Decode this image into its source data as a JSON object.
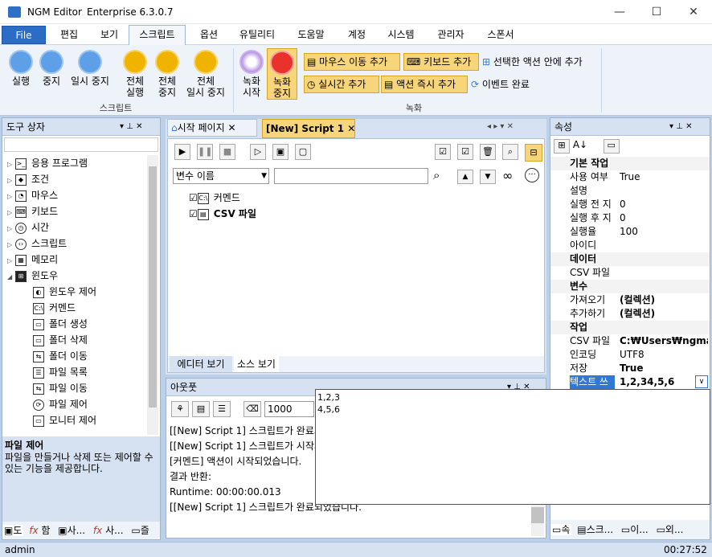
{
  "app": {
    "name": "NGM Editor",
    "edition": "Enterprise 6.3.0.7"
  },
  "window": {
    "minimize": "—",
    "maximize": "☐",
    "close": "✕"
  },
  "menu": {
    "file": "File",
    "items": [
      "편집",
      "보기",
      "스크립트",
      "옵션",
      "유틸리티",
      "도움말",
      "계정",
      "시스템",
      "관리자",
      "스폰서"
    ]
  },
  "ribbon": {
    "script_buttons": [
      "실행",
      "중지",
      "일시 중지"
    ],
    "batch_buttons": [
      [
        "전체",
        "실행"
      ],
      [
        "전체",
        "중지"
      ],
      [
        "전체",
        "일시 중지"
      ]
    ],
    "group_script": "스크립트",
    "record_buttons": [
      [
        "녹화",
        "시작"
      ],
      [
        "녹화",
        "중지"
      ]
    ],
    "small": [
      "마우스 이동 추가",
      "키보드 추가",
      "선택한 액션 안에 추가",
      "실시간 추가",
      "액션 즉시 추가",
      "이벤트 완료"
    ],
    "group_record": "녹화"
  },
  "toolbox": {
    "title": "도구 상자",
    "items": [
      "응용 프로그램",
      "조건",
      "마우스",
      "키보드",
      "시간",
      "스크립트",
      "메모리",
      "윈도우"
    ],
    "children": [
      "윈도우 제어",
      "커멘드",
      "폴더 생성",
      "폴더 삭제",
      "폴더 이동",
      "파일 목록",
      "파일 이동",
      "파일 제어",
      "모니터 제어"
    ],
    "desc_title": "파일 제어",
    "desc_text": "파일을 만들거나 삭제 또는 제어할 수 있는 기능을 제공합니다.",
    "bottom_tabs": [
      "도",
      "함",
      "사...",
      "사...",
      "즐"
    ]
  },
  "editor": {
    "tab_start": "시작 페이지",
    "tab_script": "[New] Script 1",
    "var_select": "변수 이름",
    "nodes": [
      "커멘드",
      "CSV 파일"
    ],
    "view_tabs": [
      "에디터 보기",
      "소스 보기"
    ]
  },
  "output": {
    "title": "아웃풋",
    "count": "1000",
    "lines": [
      "[[New] Script 1] 스크립트가 완료되었습니다.",
      "[[New] Script 1] 스크립트가 시작되었습니다.",
      "[커멘드] 액션이 시작되었습니다.",
      "결과 반환:",
      "Runtime: 00:00:00.013",
      "[[New] Script 1] 스크립트가 완료되었습니다."
    ]
  },
  "properties": {
    "title": "속성",
    "sections": {
      "basic": "기본 작업",
      "data": "데이터",
      "var": "변수",
      "work": "작업"
    },
    "basic": [
      [
        "사용 여부",
        "True"
      ],
      [
        "설명",
        ""
      ],
      [
        "실행 전 지",
        "0"
      ],
      [
        "실행 후 지",
        "0"
      ],
      [
        "실행율",
        "100"
      ],
      [
        "아이디",
        ""
      ]
    ],
    "data": [
      [
        "CSV 파일",
        ""
      ]
    ],
    "var": [
      [
        "가져오기",
        "(컬렉션)"
      ],
      [
        "추가하기",
        "(컬렉션)"
      ]
    ],
    "work": [
      [
        "CSV 파일",
        "C:₩Users₩ngma"
      ],
      [
        "인코딩",
        "UTF8"
      ],
      [
        "저장",
        "True"
      ]
    ],
    "selected": [
      "텍스트 쓰",
      "1,2,34,5,6"
    ],
    "bottom_tabs": [
      "속",
      "스크...",
      "이...",
      "외..."
    ]
  },
  "popup": {
    "lines": [
      "1,2,3",
      "4,5,6"
    ]
  },
  "status": {
    "user": "admin",
    "time": "00:27:52"
  }
}
